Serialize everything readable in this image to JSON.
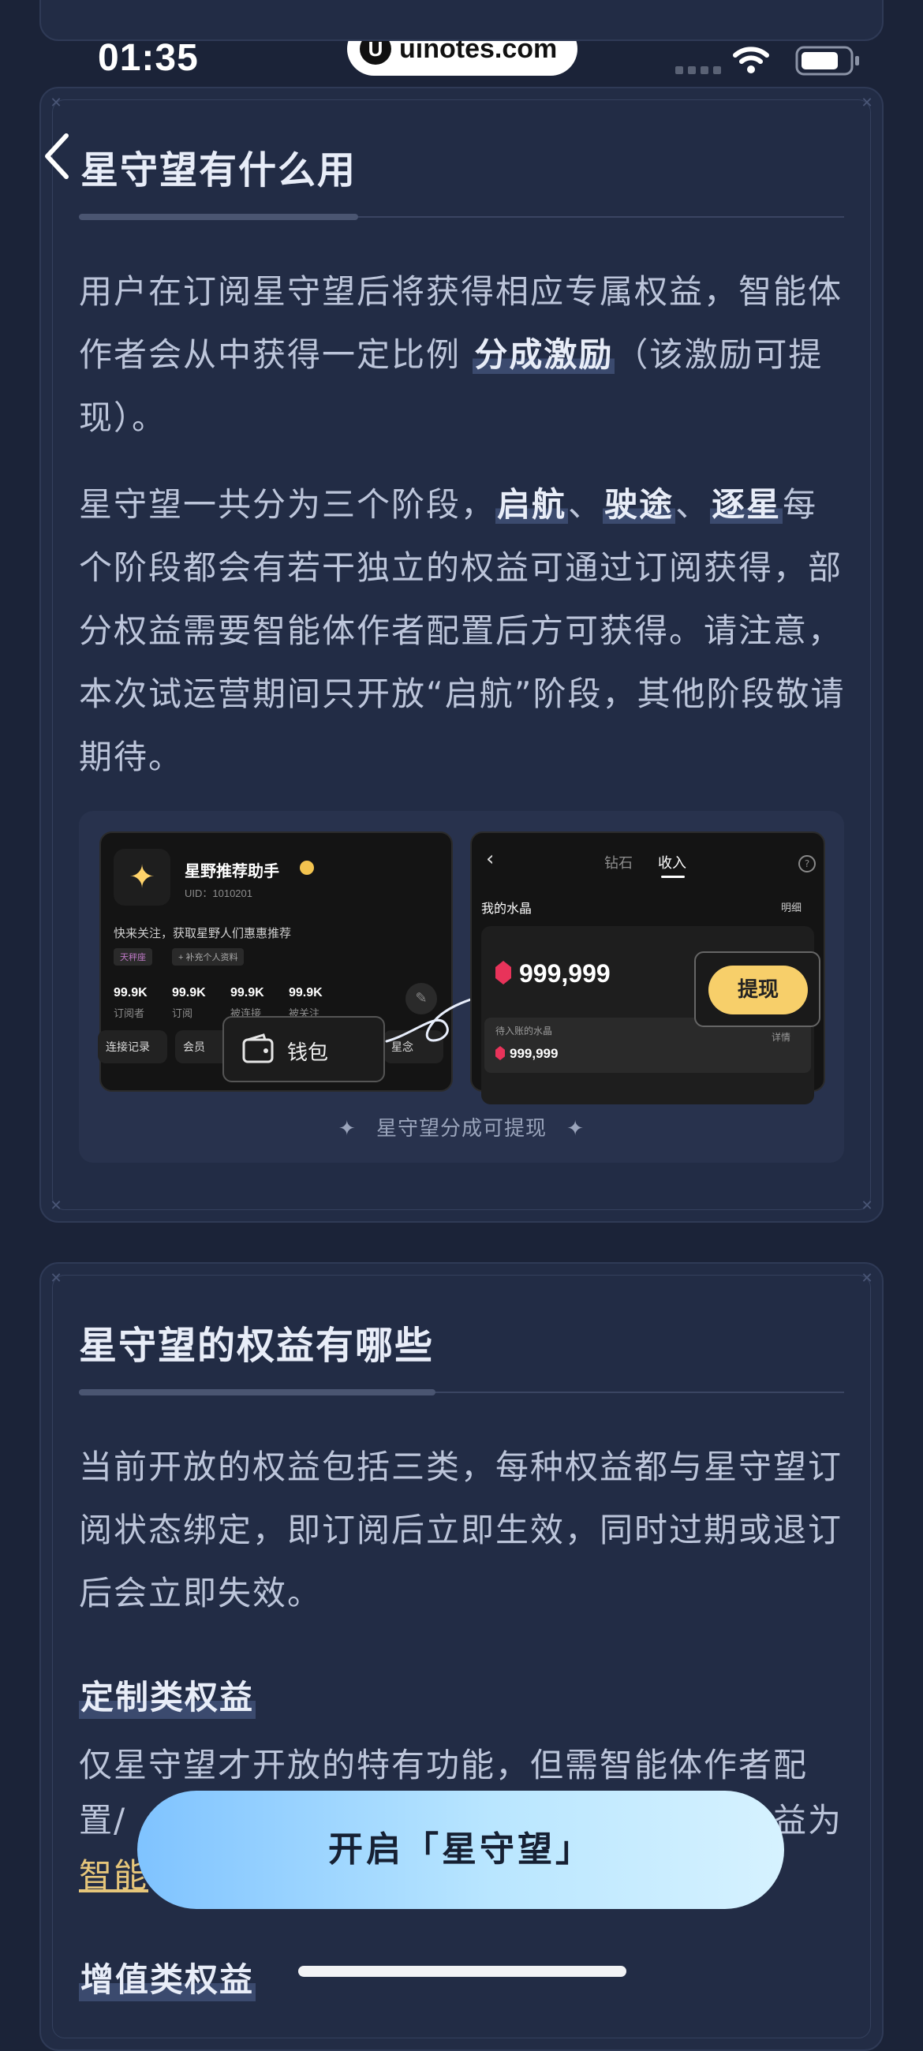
{
  "status_bar": {
    "time": "01:35"
  },
  "watermark": {
    "logo": "U",
    "text": "uinotes.com"
  },
  "section1": {
    "title": "星守望有什么用",
    "p1_a": "用户在订阅星守望后将获得相应专属权益，智能体作者会从中获得一定比例",
    "p1_bold": "分成激励",
    "p1_b": "（该激励可提现）。",
    "p2_a": "星守望一共分为三个阶段，",
    "stage1": "启航",
    "sep": "、",
    "stage2": "驶途",
    "stage3": "逐星",
    "p2_b": "每个阶段都会有若干独立的权益可通过订阅获得，部分权益需要智能体作者配置后方可获得。请注意，本次试运营期间只开放“启航”阶段，其他阶段敬请期待。",
    "illustration": {
      "profile_name": "星野推荐助手",
      "uid": "UID：1010201",
      "intro": "快来关注，获取星野人们惠惠推荐",
      "tag1": "天秤座",
      "tag2": "+ 补充个人资料",
      "stats": [
        {
          "num": "99.9K",
          "label": "订阅者"
        },
        {
          "num": "99.9K",
          "label": "订阅"
        },
        {
          "num": "99.9K",
          "label": "被连接"
        },
        {
          "num": "99.9K",
          "label": "被关注"
        }
      ],
      "btn_records": "连接记录",
      "btn_member": "会员",
      "btn_star": "星念",
      "wallet_label": "钱包",
      "tab_diamond": "钻石",
      "tab_income": "收入",
      "crystal_title": "我的水晶",
      "detail": "明细",
      "crystal_amount": "999,999",
      "withdraw": "提现",
      "pending_title": "待入账的水晶",
      "pending_detail": "详情",
      "pending_amount": "999,999",
      "caption": "星守望分成可提现"
    }
  },
  "section2": {
    "title": "星守望的权益有哪些",
    "p1": "当前开放的权益包括三类，每种权益都与星守望订阅状态绑定，即订阅后立即生效，同时过期或退订后会立即失效。",
    "h_custom": "定制类权益",
    "p_custom_1": "仅星守望才开放的特有功能，但需智能体作者配",
    "p_custom_2a": "置/",
    "p_custom_2b": "益为",
    "p_custom_link": "智能",
    "h_value": "增值类权益"
  },
  "cta": {
    "label": "开启「星守望」"
  }
}
